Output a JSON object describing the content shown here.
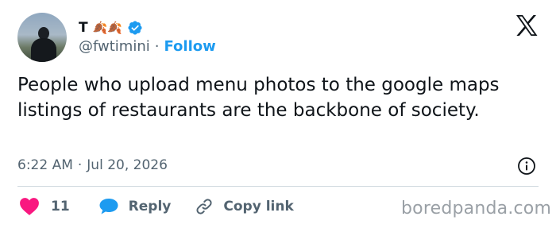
{
  "author": {
    "display_name": "T",
    "emojis": "🍂🍂",
    "handle": "@fwtimini",
    "separator": "·",
    "follow_label": "Follow"
  },
  "tweet": {
    "text": "People who upload menu photos to the google maps listings of restaurants are the backbone of society.",
    "time": "6:22 AM",
    "separator": "·",
    "date": "Jul 20, 2026"
  },
  "actions": {
    "like_count": "11",
    "reply_label": "Reply",
    "copy_label": "Copy link"
  },
  "watermark": "boredpanda.com",
  "icons": [
    "x-logo-icon",
    "verified-badge-icon",
    "info-icon",
    "heart-icon",
    "reply-bubble-icon",
    "link-icon"
  ],
  "colors": {
    "accent": "#1d9bf0",
    "like": "#f91880",
    "text": "#0f1419",
    "muted": "#536471",
    "divider": "#cfd9de"
  }
}
